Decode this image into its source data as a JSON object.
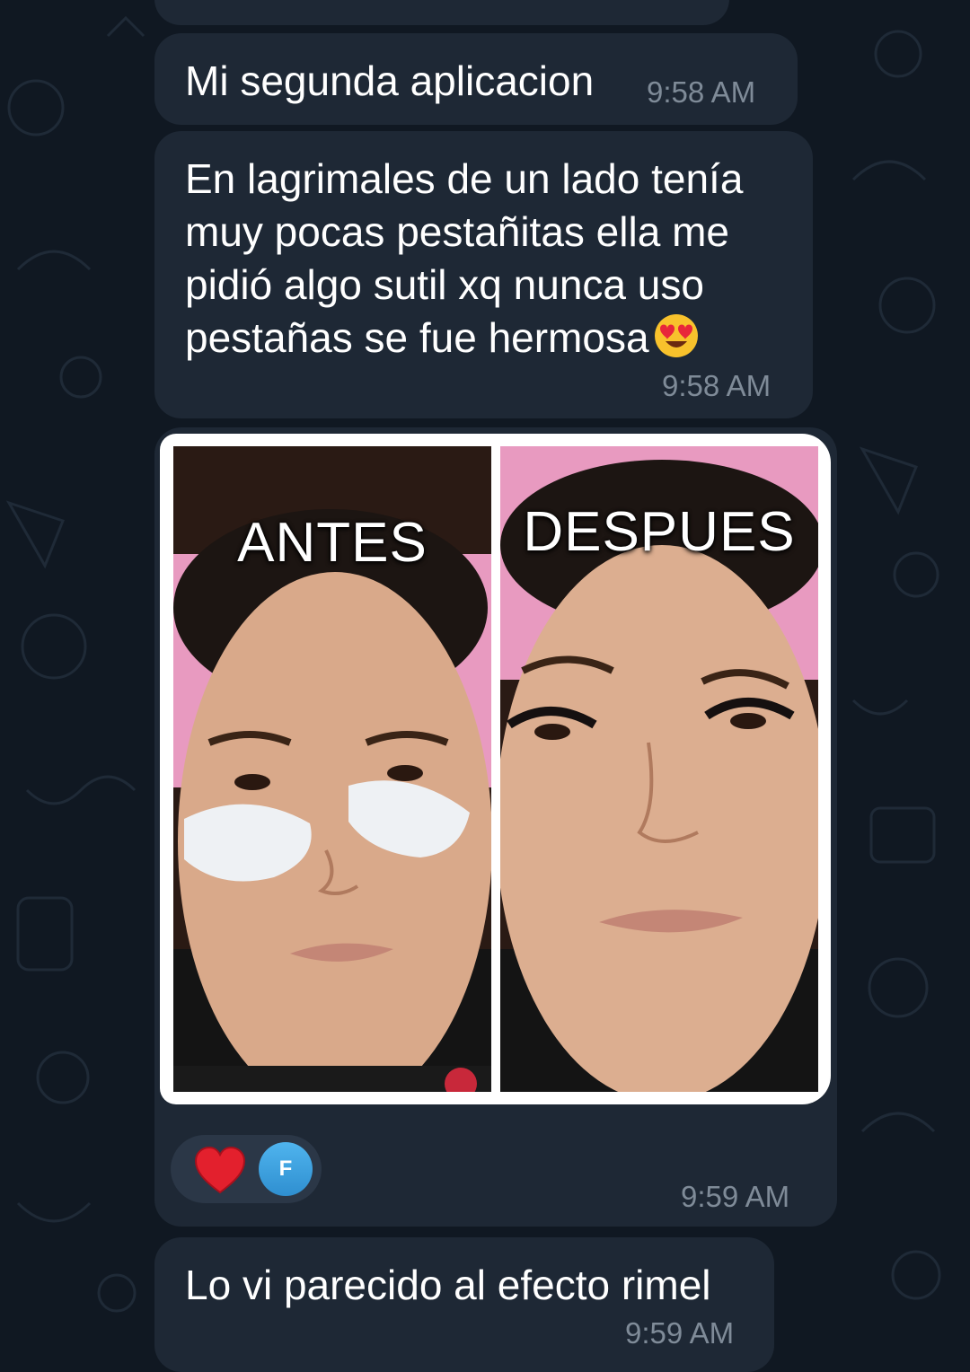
{
  "messages": [
    {
      "text": "Mi segunda aplicacion",
      "time": "9:58 AM"
    },
    {
      "text": "En lagrimales de un lado tenía\nmuy pocas pestañitas ella me\npidió algo sutil xq nunca uso\npestañas se fue hermosa",
      "emoji": "heart-eyes-emoji",
      "time": "9:58 AM"
    },
    {
      "type": "photo",
      "labels": {
        "before": "ANTES",
        "after": "DESPUES"
      },
      "reaction": "heart-emoji",
      "reactor_initial": "F",
      "time": "9:59 AM"
    },
    {
      "text": "Lo vi parecido al efecto rimel",
      "time": "9:59 AM"
    }
  ],
  "colors": {
    "background": "#101822",
    "bubble": "#1e2835",
    "time": "#7f8b98",
    "reaction_pill": "#2b3747"
  }
}
